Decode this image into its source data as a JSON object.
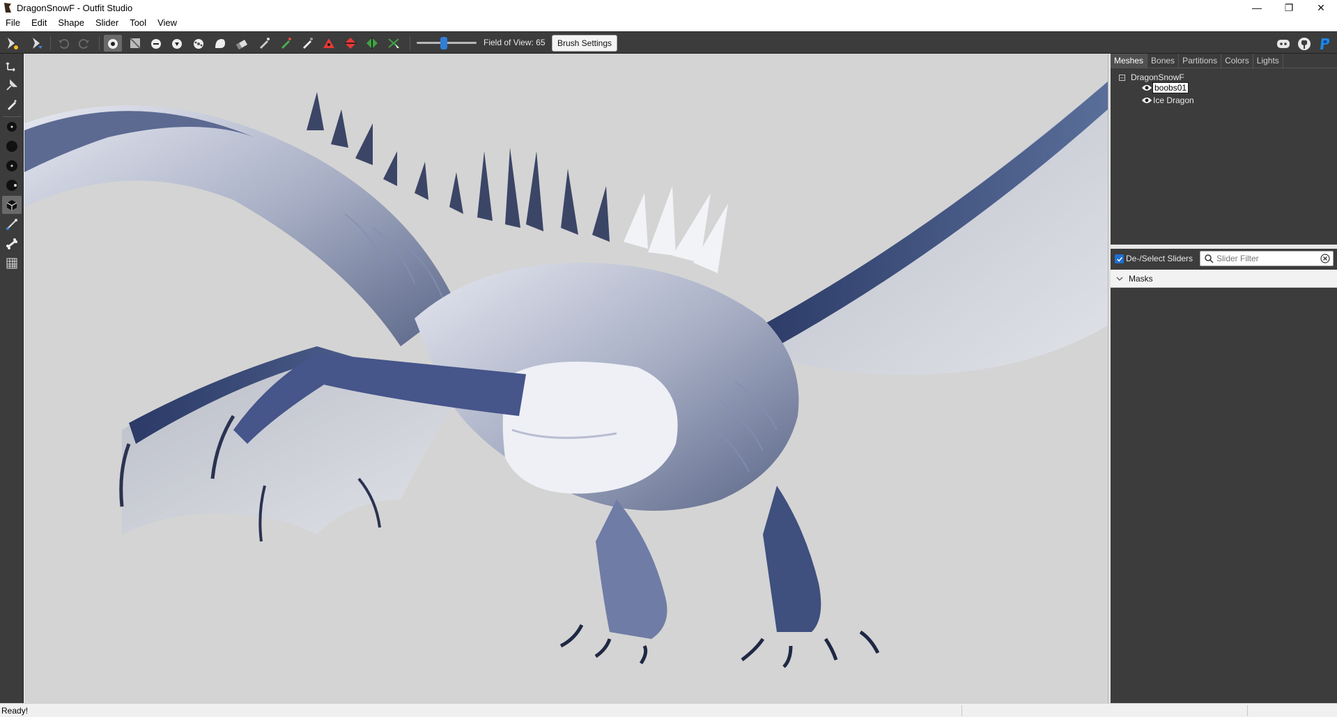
{
  "window": {
    "title": "DragonSnowF - Outfit Studio",
    "minimize": "—",
    "maximize": "❐",
    "close": "✕"
  },
  "menu": [
    "File",
    "Edit",
    "Shape",
    "Slider",
    "Tool",
    "View"
  ],
  "toolbar": {
    "fov_label": "Field of View: 65",
    "fov_value": 65,
    "brush_settings_label": "Brush Settings"
  },
  "right_panel": {
    "tabs": [
      "Meshes",
      "Bones",
      "Partitions",
      "Colors",
      "Lights"
    ],
    "active_tab": "Meshes",
    "tree": {
      "root": "DragonSnowF",
      "root_expander": "–",
      "items": [
        {
          "label": "boobs01",
          "selected": true
        },
        {
          "label": "Ice Dragon",
          "selected": false
        }
      ]
    },
    "slider_header": {
      "deselect_label": "De-/Select Sliders",
      "filter_placeholder": "Slider Filter"
    },
    "masks_label": "Masks"
  },
  "status": {
    "text": "Ready!"
  },
  "colors": {
    "toolbar_bg": "#3c3c3c",
    "viewport_bg": "#d4d4d4",
    "accent": "#1f6fd0"
  }
}
